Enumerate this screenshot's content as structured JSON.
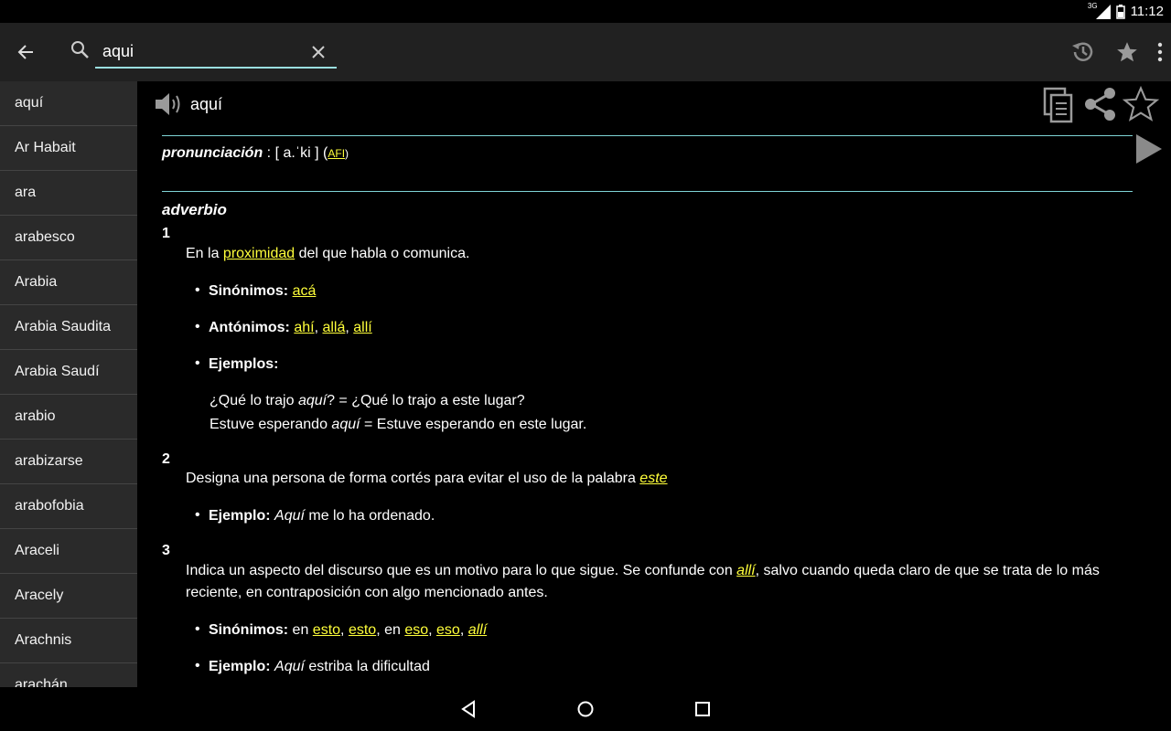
{
  "status": {
    "network": "3G",
    "time": "11:12"
  },
  "toolbar": {
    "search_value": "aqui",
    "icons": [
      "back-arrow-icon",
      "search-icon",
      "close-icon",
      "history-icon",
      "star-icon",
      "more-vert-icon"
    ]
  },
  "sidebar": {
    "items": [
      {
        "label": "aquí"
      },
      {
        "label": "Ar Habait"
      },
      {
        "label": "ara"
      },
      {
        "label": "arabesco"
      },
      {
        "label": "Arabia"
      },
      {
        "label": "Arabia Saudita"
      },
      {
        "label": "Arabia Saudí"
      },
      {
        "label": "arabio"
      },
      {
        "label": "arabizarse"
      },
      {
        "label": "arabofobia"
      },
      {
        "label": "Araceli"
      },
      {
        "label": "Aracely"
      },
      {
        "label": "Arachnis"
      },
      {
        "label": "arachán"
      }
    ]
  },
  "entry": {
    "headword": "aquí",
    "pron_label": "pronunciación",
    "pron_value": " : [ a.ˈki ] (",
    "afi": "AFI",
    "afi_close": ")",
    "pos": "adverbio",
    "senses": {
      "s1": {
        "num": "1",
        "def_a": "En la ",
        "def_link": "proximidad",
        "def_b": " del que habla o comunica.",
        "syn_label": "Sinónimos:",
        "syn_1": "acá",
        "ant_label": "Antónimos:",
        "ant_1": "ahí",
        "ant_2": "allá",
        "ant_3": "allí",
        "ex_label": "Ejemplos:",
        "ex1_a": "¿Qué lo trajo ",
        "ex1_i": "aquí",
        "ex1_b": "? = ¿Qué lo trajo a este lugar?",
        "ex2_a": "Estuve esperando ",
        "ex2_i": "aquí",
        "ex2_b": " = Estuve esperando en este lugar."
      },
      "s2": {
        "num": "2",
        "def_a": "Designa una persona de forma cortés para evitar el uso de la palabra ",
        "def_link": "este",
        "ex_label": "Ejemplo:",
        "ex_i": "Aquí",
        "ex_b": " me lo ha ordenado."
      },
      "s3": {
        "num": "3",
        "def_a": "Indica un aspecto del discurso que es un motivo para lo que sigue. Se confunde con ",
        "def_link": "allí",
        "def_b": ", salvo cuando queda claro de que se trata de lo más reciente, en contraposición con algo mencionado antes.",
        "syn_label": "Sinónimos:",
        "syn_en1": " en ",
        "syn_1": "esto",
        "syn_2": "esto",
        "syn_en2": ", en ",
        "syn_3": "eso",
        "syn_4": "eso",
        "syn_5": "allí",
        "ex_label": "Ejemplo:",
        "ex_i": "Aquí",
        "ex_b": " estriba la dificultad"
      }
    }
  },
  "colors": {
    "link": "#ffff3a",
    "rule": "#7fd4d6",
    "toolbar_bg": "#212121",
    "sidebar_bg": "#2a2a2a"
  }
}
